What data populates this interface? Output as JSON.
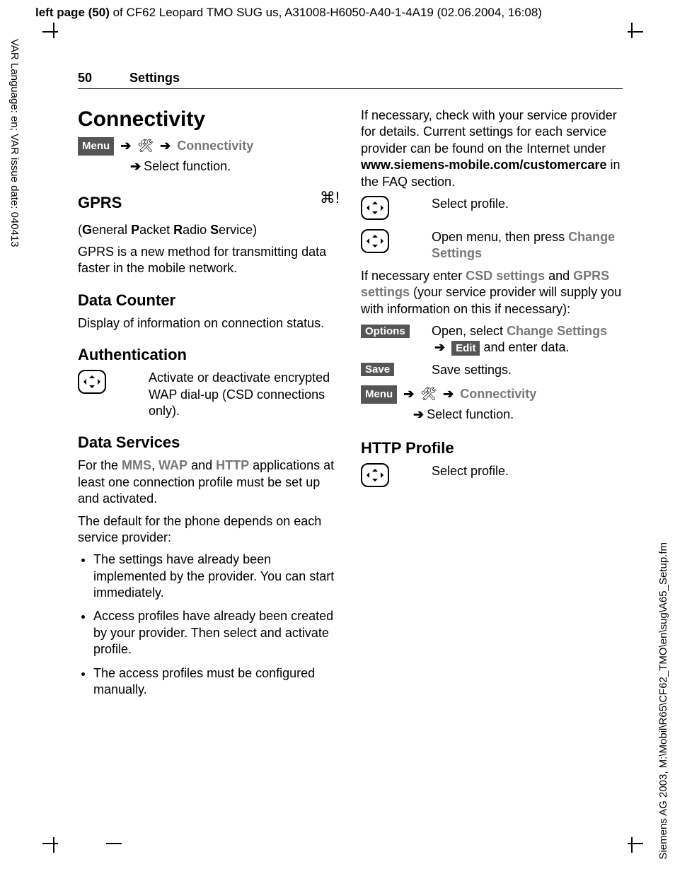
{
  "meta": {
    "top_bold": "left page (50)",
    "top_rest": " of CF62 Leopard TMO SUG us, A31008-H6050-A40-1-4A19 (02.06.2004, 16:08)",
    "left_margin": "VAR Language: en; VAR issue date: 040413",
    "right_margin": "Siemens AG 2003, M:\\Mobil\\R65\\CF62_TMO\\en\\sug\\A65_Setup.fm"
  },
  "header": {
    "page_num": "50",
    "section": "Settings"
  },
  "left": {
    "h1": "Connectivity",
    "menu_label": "Menu",
    "nav_connectivity": "Connectivity",
    "nav_select": "Select function.",
    "gprs_h": "GPRS",
    "gprs_expand_pre": "(",
    "gprs_expand_g": "G",
    "gprs_expand_1": "eneral ",
    "gprs_expand_p": "P",
    "gprs_expand_2": "acket ",
    "gprs_expand_r": "R",
    "gprs_expand_3": "adio ",
    "gprs_expand_s": "S",
    "gprs_expand_4": "ervice)",
    "gprs_body": "GPRS is a new method for transmitting data faster in the mobile network.",
    "datacounter_h": "Data Counter",
    "datacounter_body": "Display of information on connection status.",
    "auth_h": "Authentication",
    "auth_body": "Activate or deactivate encrypted WAP dial-up (CSD connections only).",
    "ds_h": "Data Services",
    "ds_p1_pre": "For the ",
    "ds_mms": "MMS",
    "ds_comma": ", ",
    "ds_wap": "WAP",
    "ds_and": " and ",
    "ds_http": "HTTP",
    "ds_p1_post": " applications at least one connection profile must be set up and activated.",
    "ds_p2": "The default for the phone depends on each service provider:",
    "ds_b1": "The settings have already been implemented by the provider. You can start immediately.",
    "ds_b2": "Access profiles have already been created by your provider. Then select and activate profile.",
    "ds_b3": "The access profiles must be configured manually."
  },
  "right": {
    "p1_pre": "If necessary, check with your service provider for details. Current settings for each service provider can be found on the Internet under ",
    "p1_url": "www.siemens-mobile.com/customercare",
    "p1_post": " in the FAQ section.",
    "row1": "Select profile.",
    "row2_pre": "Open menu, then press ",
    "row2_cs": "Change Settings",
    "p2_pre": "If necessary enter ",
    "p2_csd": "CSD settings",
    "p2_and": " and ",
    "p2_gprs": "GPRS settings",
    "p2_post": " (your service provider will supply you with information on this if necessary):",
    "options_label": "Options",
    "options_pre": "Open, select ",
    "options_cs": "Change Settings",
    "options_arrow": " ",
    "edit_label": "Edit",
    "options_post": " and enter data.",
    "save_label": "Save",
    "save_txt": "Save settings.",
    "menu_label": "Menu",
    "nav_connectivity": "Connectivity",
    "nav_select": "Select function.",
    "http_h": "HTTP Profile",
    "http_row": "Select profile."
  }
}
